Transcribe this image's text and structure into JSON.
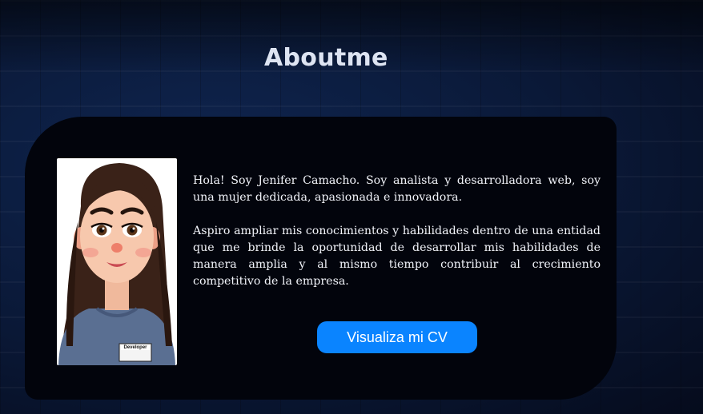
{
  "about": {
    "title": "Aboutme",
    "paragraphs": [
      "Hola! Soy Jenifer Camacho. Soy analista y desarrolladora web, soy una mujer dedicada, apasionada e innovadora.",
      "Aspiro ampliar mis conocimientos y habilidades dentro de una entidad que me brinde la oportunidad de desarrollar mis habilidades de manera amplia y al mismo tiempo contribuir al crecimiento competitivo de la empresa."
    ],
    "cv_button_label": "Visualiza mi CV",
    "avatar": {
      "icon": "developer-avatar-illustration",
      "badge_text": "Developer"
    }
  },
  "colors": {
    "page_background": "#0a1428",
    "card_background": "#02040c",
    "button": "#0a84ff",
    "title_text": "#dde4f2"
  }
}
